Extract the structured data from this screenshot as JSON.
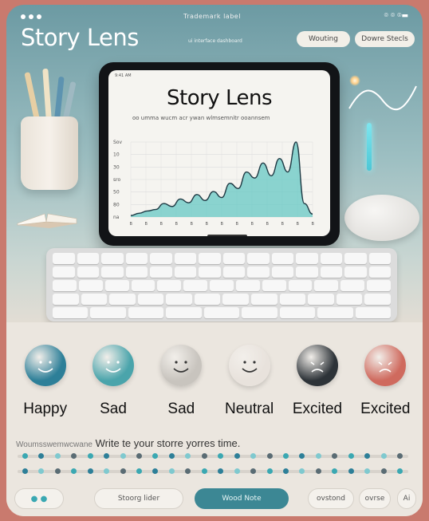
{
  "app": {
    "title": "Story Lens",
    "status_title": "Trademark label",
    "status_icons": "⌾ ⌾ ⌾▬",
    "subline": "ui interface dashboard"
  },
  "header": {
    "writing_label": "Wouting",
    "device_label": "Dowre Stecls"
  },
  "tablet": {
    "status": "9:41 AM",
    "title": "Story Lens",
    "subtitle": "oo umma wucm acr ywan wlmsemnitr ooannsem",
    "y_ticks": [
      "Sov",
      "10",
      "30",
      "sro",
      "50",
      "80",
      "na"
    ],
    "x_ticks": [
      "B",
      "B",
      "B",
      "B",
      "B",
      "B",
      "B",
      "B",
      "B",
      "B",
      "B",
      "B",
      "B"
    ]
  },
  "emotions": [
    {
      "label": "Happy",
      "mood": "happy",
      "color": "#2d7f98"
    },
    {
      "label": "Sad",
      "mood": "happy",
      "color": "#4aa4ab"
    },
    {
      "label": "Sad",
      "mood": "happy",
      "color": "#c8c4be"
    },
    {
      "label": "Neutral",
      "mood": "happy",
      "color": "#e8e2dc"
    },
    {
      "label": "Excited",
      "mood": "frown",
      "color": "#2d3338"
    },
    {
      "label": "Excited",
      "mood": "frown",
      "color": "#cf6a5e"
    }
  ],
  "prompt": {
    "prefix": "Woumsswemwcwane",
    "text": "Write te your storre yorres time."
  },
  "bottom": {
    "left_label": "",
    "mid_label": "Stoorg lider",
    "primary_label": "Wood Note",
    "right1": "ovstond",
    "right2": "ovrse",
    "right3": "Ai"
  },
  "colors": {
    "accent": "#3c8794",
    "chart_fill": "#66c8c4"
  },
  "chart_data": {
    "type": "area",
    "y": [
      2,
      5,
      8,
      10,
      18,
      14,
      24,
      19,
      30,
      22,
      34,
      26,
      45,
      38,
      60,
      52,
      72,
      55,
      78,
      60,
      100,
      18,
      4
    ]
  }
}
